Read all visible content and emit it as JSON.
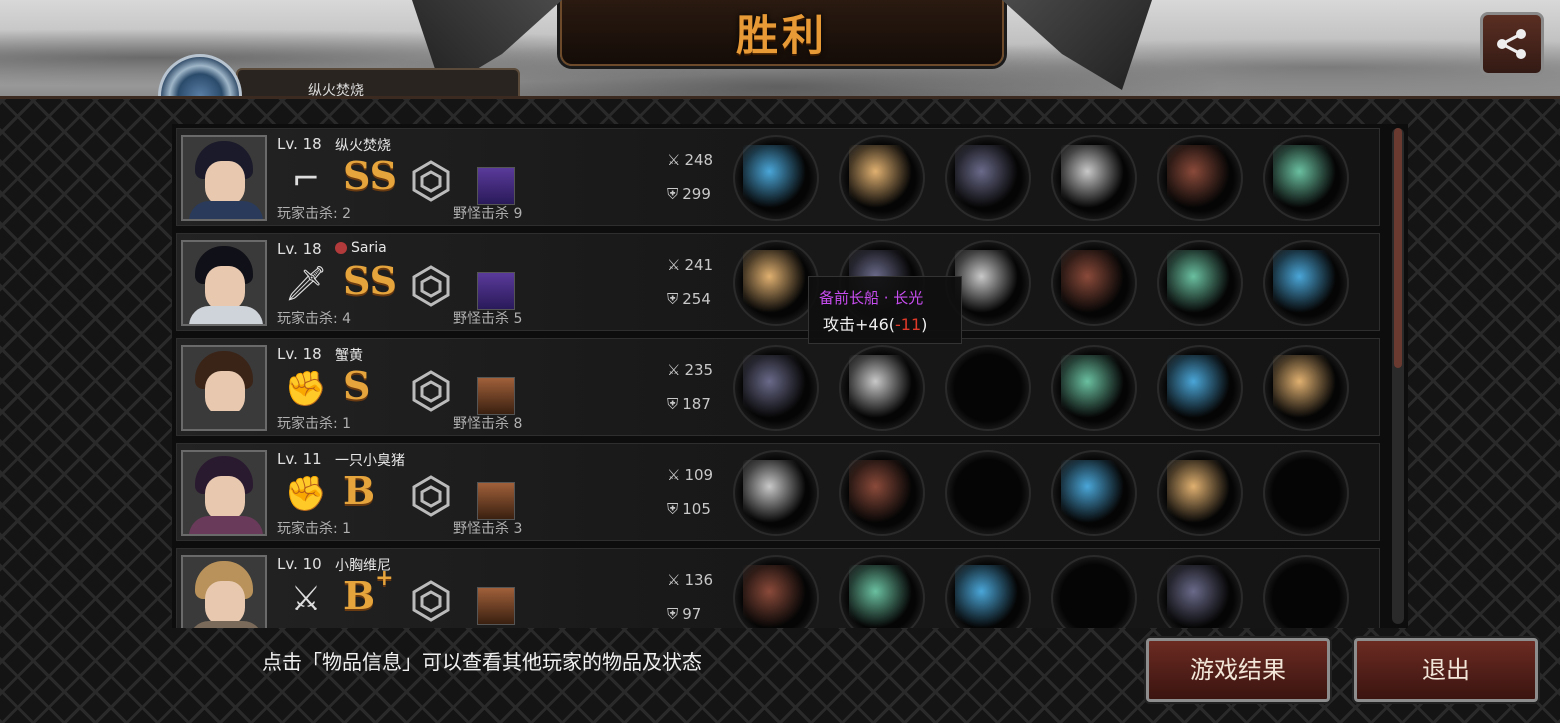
{
  "header": {
    "title": "胜利"
  },
  "self_tab": {
    "name": "纵火焚烧"
  },
  "stat_labels": {
    "player_kills": "玩家击杀",
    "monster_kills": "野怪击杀"
  },
  "players": [
    {
      "level": "Lv. 18",
      "name": "纵火焚烧",
      "rank": "SS",
      "rank_plus": "",
      "weapon": "pistol-icon",
      "player_kills": "玩家击杀: 2",
      "monster_kills": "野怪击杀 9",
      "attack": "248",
      "defense": "299",
      "items": [
        "laser-rifle-icon",
        "winged-tiara-icon",
        "dark-armor-icon",
        "feather-bracer-icon",
        "claw-gauntlet-icon",
        "scope-icon"
      ]
    },
    {
      "level": "Lv. 18",
      "name": "Saria",
      "rank": "SS",
      "rank_plus": "",
      "weapon": "knife-icon",
      "player_kills": "玩家击杀: 4",
      "monster_kills": "野怪击杀 5",
      "attack": "241",
      "defense": "254",
      "items": [
        "red-longsword-icon",
        "crown-icon",
        "flame-helmet-icon",
        "gold-chain-icon",
        "wrapped-bracer-icon",
        "blue-earrings-icon"
      ]
    },
    {
      "level": "Lv. 18",
      "name": "蟹黄",
      "rank": "S",
      "rank_plus": "",
      "weapon": "fist-icon",
      "player_kills": "玩家击杀: 1",
      "monster_kills": "野怪击杀 8",
      "attack": "235",
      "defense": "187",
      "items": [
        "red-claw-icon",
        "knight-helmet-icon",
        "empty-slot",
        "gold-shield-icon",
        "wrapped-bracer-icon",
        "hand-fan-icon"
      ]
    },
    {
      "level": "Lv. 11",
      "name": "一只小臭猪",
      "rank": "B",
      "rank_plus": "",
      "weapon": "fist-icon",
      "player_kills": "玩家击杀: 1",
      "monster_kills": "野怪击杀 3",
      "attack": "109",
      "defense": "105",
      "items": [
        "steel-gloves-icon",
        "silver-helmet-icon",
        "empty-slot",
        "jeweled-ring-icon",
        "black-boots-icon",
        "empty-slot"
      ]
    },
    {
      "level": "Lv. 10",
      "name": "小胸维尼",
      "rank": "B",
      "rank_plus": "+",
      "weapon": "rapier-icon",
      "player_kills": "",
      "monster_kills": "",
      "attack": "136",
      "defense": "97",
      "items": [
        "katana-icon",
        "thin-ring-icon",
        "dark-top-icon",
        "empty-slot",
        "red-heels-icon",
        "empty-slot"
      ]
    }
  ],
  "tooltip": {
    "name": "备前长船 · 长光",
    "stat_prefix": "攻击+46(",
    "stat_negative": "-11",
    "stat_suffix": ")"
  },
  "footer": {
    "hint": "点击「物品信息」可以查看其他玩家的物品及状态",
    "results_button": "游戏结果",
    "exit_button": "退出"
  },
  "colors": {
    "accent": "#e89a36",
    "button": "#6b2b22",
    "tooltip_name": "#c84df0",
    "negative": "#e03a2a"
  }
}
